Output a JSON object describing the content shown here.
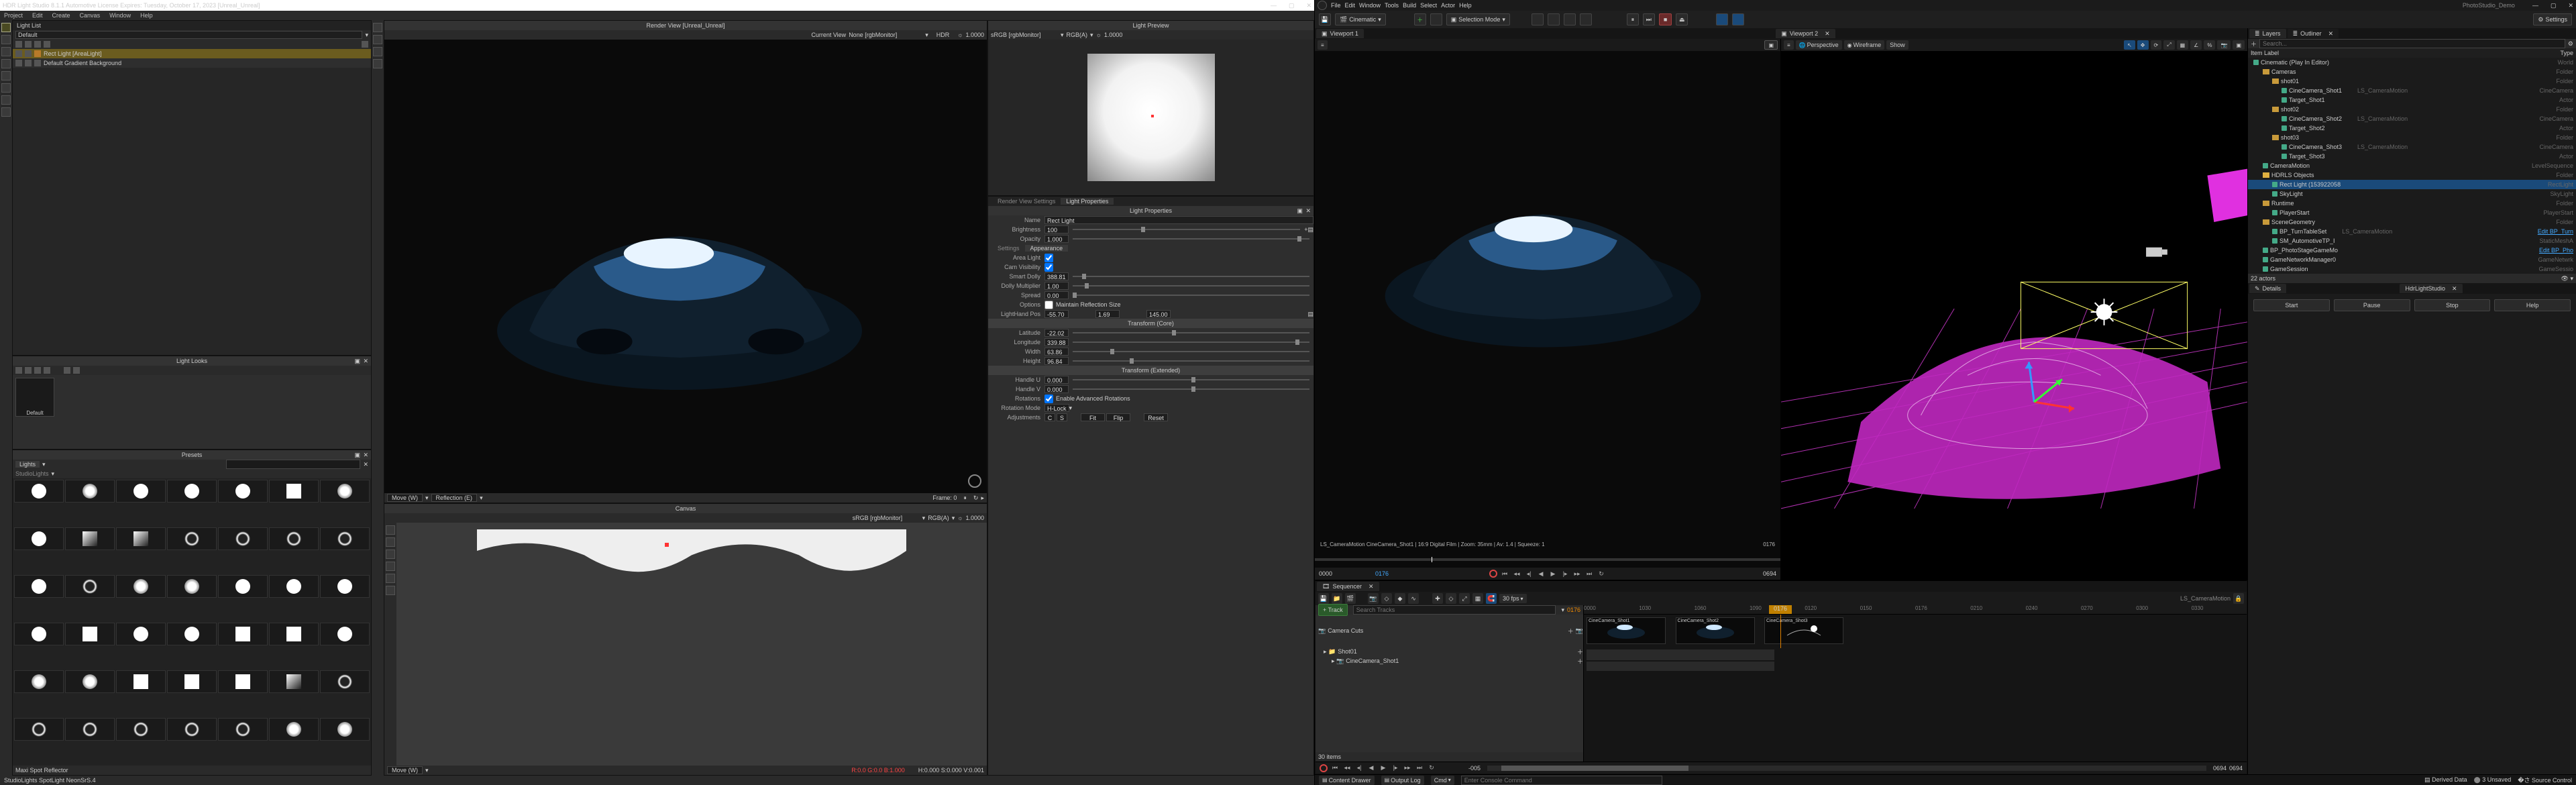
{
  "hdr": {
    "title": "HDR Light Studio 8.1.1   Automotive License Expires: Tuesday, October 17, 2023   [Unreal_Unreal]",
    "menu": [
      "Project",
      "Edit",
      "Create",
      "Canvas",
      "Window",
      "Help"
    ],
    "light_list": {
      "title": "Light List",
      "scene": "Default",
      "items": [
        {
          "name": "Rect Light  [AreaLight]",
          "sel": true
        },
        {
          "name": "Default Gradient Background",
          "sel": false
        }
      ]
    },
    "render_view": {
      "title": "Render View [Unreal_Unreal]",
      "current_view_lbl": "Current View",
      "dropdown": "None [rgbMonitor]",
      "hdr_lbl": "HDR",
      "exposure": "1.0000",
      "move_lbl": "Move (W)",
      "move2_lbl": "Reflection (E)",
      "frame_lbl": "Frame: 0"
    },
    "light_preview": {
      "title": "Light Preview",
      "cs": "sRGB [rgbMonitor]",
      "mode": "RGB(A)",
      "exposure": "1.0000"
    },
    "light_props": {
      "tab1": "Render View Settings",
      "tab2": "Light Properties",
      "panel": "Light Properties",
      "name_lbl": "Name",
      "name": "Rect Light",
      "brightness_lbl": "Brightness",
      "brightness": "100",
      "opacity_lbl": "Opacity",
      "opacity": "1.000",
      "settings_tab": "Settings",
      "appearance_tab": "Appearance",
      "area_light_lbl": "Area Light",
      "cam_vis_lbl": "Cam Visibility",
      "smart_dolly_lbl": "Smart Dolly",
      "smart_dolly": "388.81",
      "dolly_mult_lbl": "Dolly Multiplier",
      "dolly_mult": "1.00",
      "spread_lbl": "Spread",
      "spread": "0.00",
      "options_lbl": "Options",
      "maintain": "Maintain Reflection Size",
      "lhpos_lbl": "LightHand Pos",
      "lhpos": [
        "-55.70",
        "1.69",
        "145.00"
      ],
      "tcore": "Transform (Core)",
      "lat_lbl": "Latitude",
      "lat": "-22.02",
      "lon_lbl": "Longitude",
      "lon": "339.88",
      "width_lbl": "Width",
      "width": "63.86",
      "height_lbl": "Height",
      "height": "96.84",
      "text": "Transform (Extended)",
      "hu_lbl": "Handle U",
      "hu": "0.000",
      "hv_lbl": "Handle V",
      "hv": "0.000",
      "rot_lbl": "Rotations",
      "rot_enable": "Enable Advanced Rotations",
      "rotmode_lbl": "Rotation Mode",
      "rotmode": "H-Lock",
      "adj_lbl": "Adjustments",
      "c": "C",
      "s": "S",
      "fit": "Fit",
      "flip": "Flip",
      "reset": "Reset"
    },
    "looks": {
      "title": "Light Looks",
      "default": "Default"
    },
    "presets": {
      "title": "Presets",
      "lights_tab": "Lights",
      "studio_tab": "StudioLights",
      "hover": "Maxi Spot Reflector",
      "status": "StudioLights SpotLight NeonSrS.4"
    },
    "canvas": {
      "title": "Canvas",
      "cs": "sRGB [rgbMonitor]",
      "mode": "RGB(A)",
      "exposure": "1.0000",
      "move": "Move (W)",
      "status_rgb": "R:0.0  G:0.0  B:1.000",
      "status_hsv": "H:0.000 S:0.000 V:0.001"
    }
  },
  "ue": {
    "project": "PhotoStudio_Demo",
    "menu": [
      "File",
      "Edit",
      "Window",
      "Tools",
      "Build",
      "Select",
      "Actor",
      "Help"
    ],
    "toolbar": {
      "mode": "Cinematic",
      "selmode": "Selection Mode",
      "settings": "Settings"
    },
    "save_icon": "disk",
    "viewports": {
      "tab1": "Viewport 1",
      "tab2": "Viewport 2",
      "persp": "Perspective",
      "wire": "Wireframe",
      "show": "Show"
    },
    "vp1_overlay": "LS_CameraMotion CineCamera_Shot1 | 16:9 Digital Film | Zoom: 35mm | Av: 1.4 | Squeeze: 1",
    "vp1_frame": "0176",
    "transport_l": "0000",
    "transport_m": "0176",
    "transport_r": "0694",
    "layers_tab": "Layers",
    "outliner_tab": "Outliner",
    "search_ph": "Search...",
    "ol_header_l": "Item Label",
    "ol_header_r": "Type",
    "outliner": [
      {
        "d": 0,
        "n": "Cinematic (Play In Editor)",
        "t": "World",
        "ic": "world"
      },
      {
        "d": 1,
        "n": "Cameras",
        "t": "Folder",
        "ic": "folder"
      },
      {
        "d": 2,
        "n": "shot01",
        "t": "Folder",
        "ic": "folder"
      },
      {
        "d": 3,
        "n": "CineCamera_Shot1",
        "t": "CineCamera",
        "ic": "cam",
        "extra": "LS_CameraMotion"
      },
      {
        "d": 3,
        "n": "Target_Shot1",
        "t": "Actor",
        "ic": "actor"
      },
      {
        "d": 2,
        "n": "shot02",
        "t": "Folder",
        "ic": "folder"
      },
      {
        "d": 3,
        "n": "CineCamera_Shot2",
        "t": "CineCamera",
        "ic": "cam",
        "extra": "LS_CameraMotion"
      },
      {
        "d": 3,
        "n": "Target_Shot2",
        "t": "Actor",
        "ic": "actor"
      },
      {
        "d": 2,
        "n": "shot03",
        "t": "Folder",
        "ic": "folder"
      },
      {
        "d": 3,
        "n": "CineCamera_Shot3",
        "t": "CineCamera",
        "ic": "cam",
        "extra": "LS_CameraMotion"
      },
      {
        "d": 3,
        "n": "Target_Shot3",
        "t": "Actor",
        "ic": "actor"
      },
      {
        "d": 1,
        "n": "CameraMotion",
        "t": "LevelSequence",
        "ic": "seq"
      },
      {
        "d": 1,
        "n": "HDRLS Objects",
        "t": "Folder",
        "ic": "folder-y"
      },
      {
        "d": 2,
        "n": "Rect Light (153922058",
        "t": "RectLight",
        "ic": "light",
        "sel": true
      },
      {
        "d": 2,
        "n": "SkyLight",
        "t": "SkyLight",
        "ic": "light"
      },
      {
        "d": 1,
        "n": "Runtime",
        "t": "Folder",
        "ic": "folder"
      },
      {
        "d": 2,
        "n": "PlayerStart",
        "t": "PlayerStart",
        "ic": "actor"
      },
      {
        "d": 1,
        "n": "SceneGeometry",
        "t": "Folder",
        "ic": "folder"
      },
      {
        "d": 2,
        "n": "BP_TurnTableSet",
        "t": "Edit BP_Turn",
        "ic": "bp",
        "extra": "LS_CameraMotion",
        "link": true
      },
      {
        "d": 2,
        "n": "SM_AutomotiveTP_I",
        "t": "StaticMeshA",
        "ic": "mesh"
      },
      {
        "d": 1,
        "n": "BP_PhotoStageGameMo",
        "t": "Edit BP_Pho",
        "ic": "bp",
        "link": true
      },
      {
        "d": 1,
        "n": "GameNetworkManager0",
        "t": "GameNetwrk",
        "ic": "actor"
      },
      {
        "d": 1,
        "n": "GameSession",
        "t": "GameSessio",
        "ic": "actor"
      }
    ],
    "actors_count": "22 actors",
    "details_tab": "Details",
    "hdrls_tab": "HdrLightStudio",
    "play_btns": [
      "Start",
      "Pause",
      "Stop",
      "Help"
    ],
    "sequencer": {
      "tab": "Sequencer",
      "title": "LS_CameraMotion",
      "fps": "30 fps",
      "track_btn": "+ Track",
      "search_ph": "Search Tracks",
      "cur": "0176",
      "ruler": [
        "0000",
        "1030",
        "1060",
        "1090",
        "0120",
        "0150",
        "0176",
        "0210",
        "0240",
        "0270",
        "0300",
        "0330"
      ],
      "camera_cuts": "Camera Cuts",
      "shots": [
        "CineCamera_Shot1",
        "CineCamera_Shot2",
        "CineCamera_Shot3"
      ],
      "shot_track": "Shot01",
      "cam_track": "CineCamera_Shot1",
      "items": "30 items",
      "range_l": "-005",
      "range_r": "0694",
      "range_r2": "0694"
    },
    "statusbar": {
      "drawer": "Content Drawer",
      "output": "Output Log",
      "cmd": "Cmd",
      "cmd_ph": "Enter Console Command",
      "derived": "Derived Data",
      "unsaved": "3 Unsaved",
      "source": "Source Control"
    }
  }
}
